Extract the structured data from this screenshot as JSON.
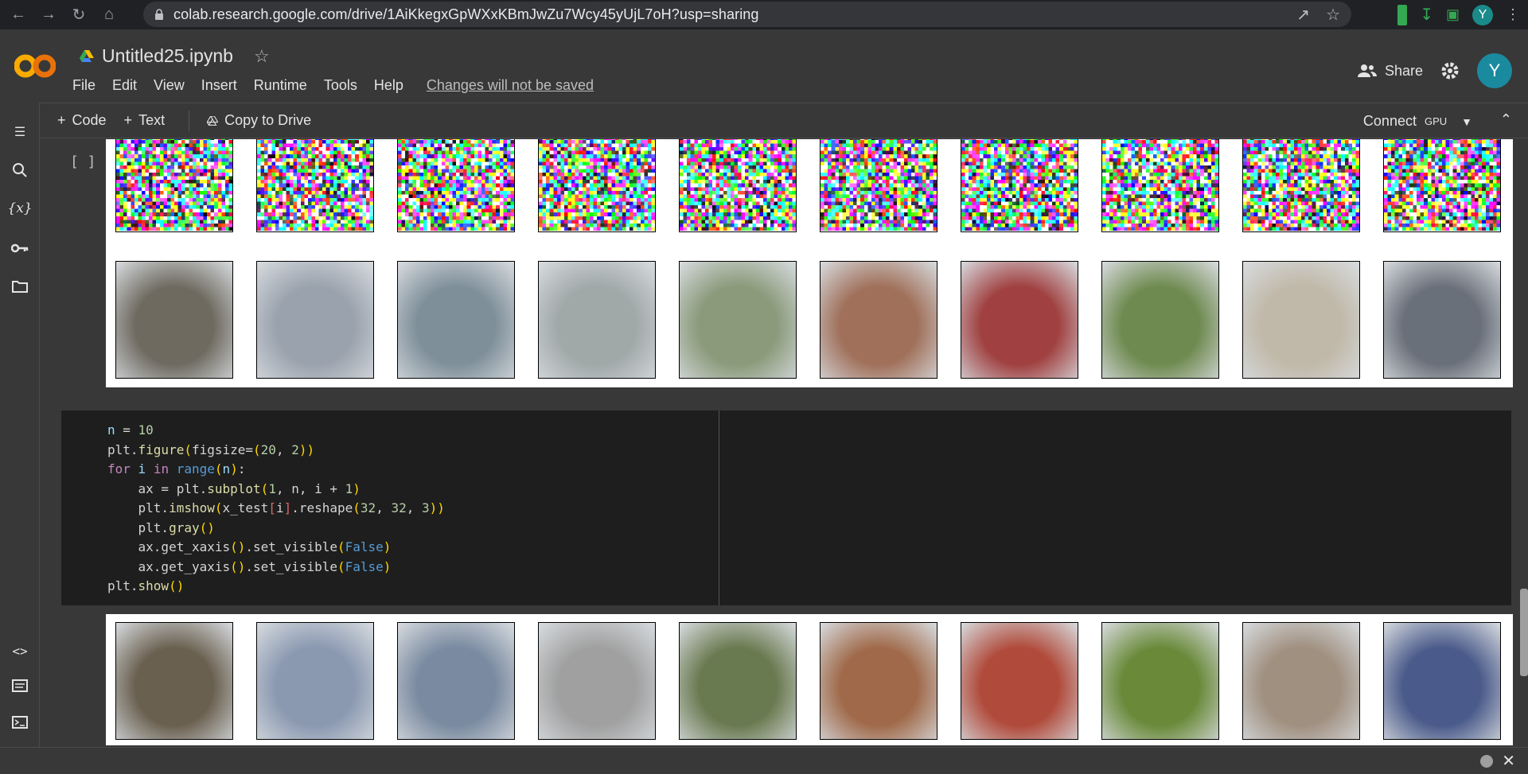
{
  "browser": {
    "url": "colab.research.google.com/drive/1AiKkegxGpWXxKBmJwZu7Wcy45yUjL7oH?usp=sharing",
    "profile_initial": "Y"
  },
  "header": {
    "doc_title": "Untitled25.ipynb",
    "menu": [
      "File",
      "Edit",
      "View",
      "Insert",
      "Runtime",
      "Tools",
      "Help"
    ],
    "unsaved_notice": "Changes will not be saved",
    "share_label": "Share",
    "avatar_initial": "Y"
  },
  "toolbar": {
    "code_label": "Code",
    "text_label": "Text",
    "copy_label": "Copy to Drive",
    "connect_label": "Connect",
    "gpu_label": "GPU"
  },
  "cells": {
    "bracket_1": "[ ]",
    "bracket_2": "[ ]",
    "code_lines": [
      "n = 10",
      "plt.figure(figsize=(20, 2))",
      "for i in range(n):",
      "    ax = plt.subplot(1, n, i + 1)",
      "    plt.imshow(x_test[i].reshape(32, 32, 3))",
      "    plt.gray()",
      "    ax.get_xaxis().set_visible(False)",
      "    ax.get_yaxis().set_visible(False)",
      "plt.show()"
    ]
  },
  "images": {
    "noisy_row": [
      "#c85fb0",
      "#a49080",
      "#8a7fb2",
      "#b57fc2",
      "#7f8fa3",
      "#b08db0",
      "#6e4c6e",
      "#8fa27f",
      "#a7a0c2",
      "#8e7a9a"
    ],
    "recon_row": [
      "#6e6a60",
      "#9aa2ad",
      "#7f8f9a",
      "#a0a8a8",
      "#8a9a7a",
      "#a0705a",
      "#a04040",
      "#6f8a50",
      "#c0b8a8",
      "#6a707a"
    ],
    "orig_row": [
      "#6a6050",
      "#8a98b0",
      "#7a8aa0",
      "#a0a0a0",
      "#6a7a50",
      "#a06a4a",
      "#b04a3a",
      "#6a8a3a",
      "#a09080",
      "#4a5a8a"
    ]
  }
}
